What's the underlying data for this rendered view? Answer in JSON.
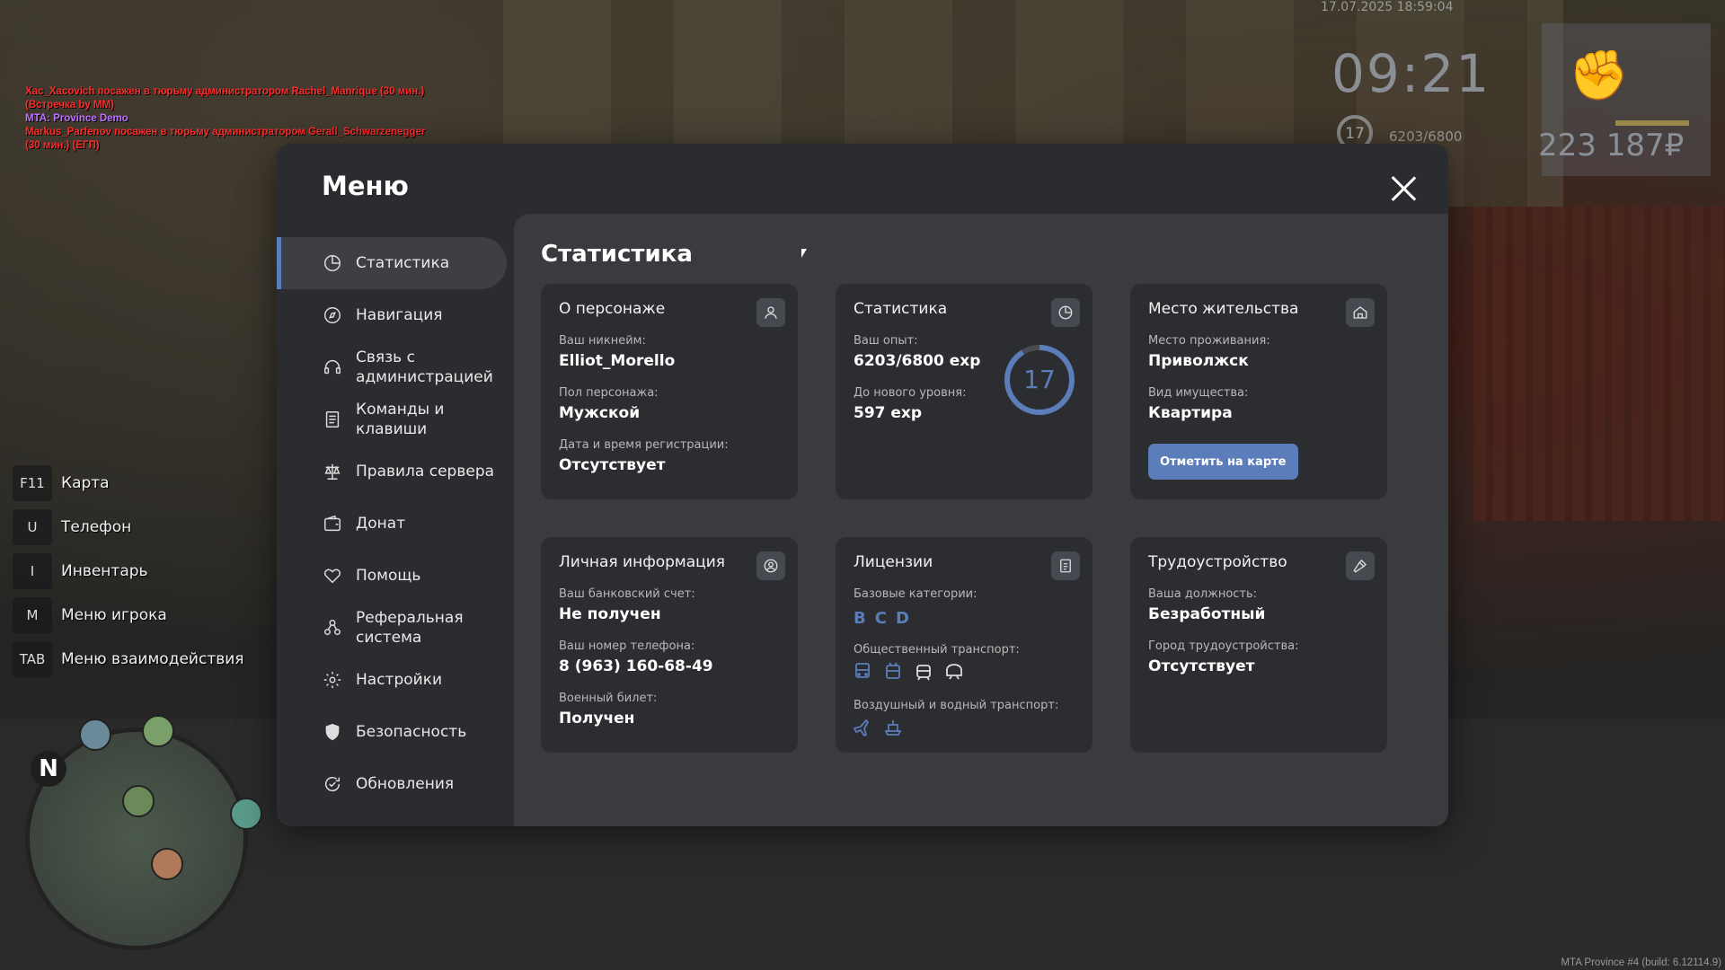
{
  "chat": [
    {
      "text": "Xac_Xacovich посажен в тюрьму администратором Rachel_Manrique (30 мин.)",
      "color": "red"
    },
    {
      "text": "(Встречка by MM)",
      "color": "red"
    },
    {
      "text": "MTA: Province Demo",
      "color": "purple"
    },
    {
      "text": "Markus_Parfenov посажен в тюрьму администратором Gerall_Schwarzenegger",
      "color": "red"
    },
    {
      "text": "(30 мин.) (ЕГП)",
      "color": "red"
    }
  ],
  "hud": {
    "date": "17.07.2025 18:59:04",
    "time": "09:21",
    "level": "17",
    "exp": "6203/6800",
    "money": "223 187₽"
  },
  "hotkeys": [
    {
      "key": "F11",
      "label": "Карта"
    },
    {
      "key": "U",
      "label": "Телефон"
    },
    {
      "key": "I",
      "label": "Инвентарь"
    },
    {
      "key": "M",
      "label": "Меню игрока"
    },
    {
      "key": "TAB",
      "label": "Меню взаимодействия"
    }
  ],
  "radar": {
    "north": "N"
  },
  "version": "MTA Province #4 (build: 6.12114.9)",
  "menu": {
    "title": "Меню",
    "nav": [
      {
        "label": "Статистика",
        "icon": "pie-chart-icon",
        "active": true
      },
      {
        "label": "Навигация",
        "icon": "compass-icon"
      },
      {
        "label": "Связь с администрацией",
        "icon": "headset-icon"
      },
      {
        "label": "Команды и клавиши",
        "icon": "document-list-icon"
      },
      {
        "label": "Правила сервера",
        "icon": "scales-icon"
      },
      {
        "label": "Донат",
        "icon": "wallet-icon"
      },
      {
        "label": "Помощь",
        "icon": "heart-hand-icon"
      },
      {
        "label": "Реферальная система",
        "icon": "referral-icon"
      },
      {
        "label": "Настройки",
        "icon": "gear-icon"
      },
      {
        "label": "Безопасность",
        "icon": "shield-icon"
      },
      {
        "label": "Обновления",
        "icon": "refresh-check-icon"
      }
    ],
    "content_title": "Статистика",
    "character": {
      "title": "О персонаже",
      "nickname_label": "Ваш никнейм:",
      "nickname": "Elliot_Morello",
      "gender_label": "Пол персонажа:",
      "gender": "Мужской",
      "reg_label": "Дата и время регистрации:",
      "reg": "Отсутствует"
    },
    "stats": {
      "title": "Статистика",
      "exp_label": "Ваш опыт:",
      "exp": "6203/6800 exp",
      "next_label": "До нового уровня:",
      "next": "597 exp",
      "level": "17",
      "progress": 0.912
    },
    "residence": {
      "title": "Место жительства",
      "place_label": "Место проживания:",
      "place": "Приволжск",
      "type_label": "Вид имущества:",
      "type": "Квартира",
      "button": "Отметить на карте"
    },
    "personal": {
      "title": "Личная информация",
      "bank_label": "Ваш банковский счет:",
      "bank": "Не получен",
      "phone_label": "Ваш номер телефона:",
      "phone": "8 (963) 160-68-49",
      "military_label": "Военный билет:",
      "military": "Получен"
    },
    "licenses": {
      "title": "Лицензии",
      "basic_label": "Базовые категории:",
      "basic": [
        "B",
        "C",
        "D"
      ],
      "public_label": "Общественный транспорт:",
      "air_label": "Воздушный и водный транспорт:"
    },
    "employment": {
      "title": "Трудоустройство",
      "position_label": "Ваша должность:",
      "position": "Безработный",
      "city_label": "Город трудоустройства:",
      "city": "Отсутствует"
    }
  }
}
